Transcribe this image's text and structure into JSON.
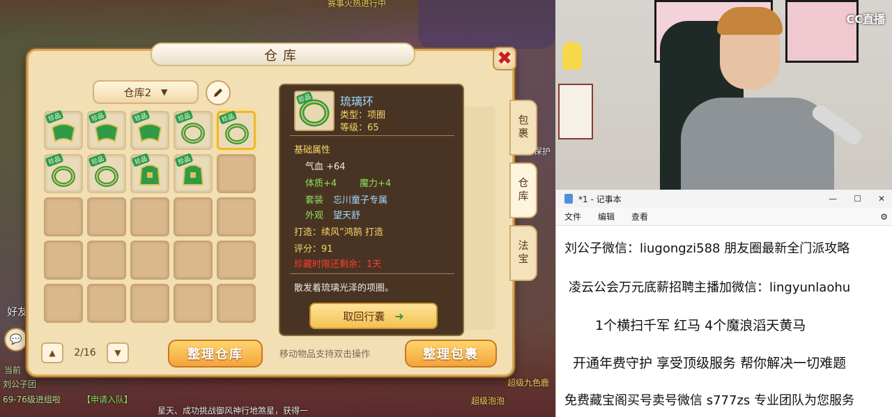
{
  "game": {
    "bg_texts": {
      "top_banner": "赛事火热进行中",
      "left_friend": "好友",
      "left_now": "当前",
      "party_recruit": "【申请入队】",
      "level_recruit": "69-76级进组啦",
      "bottom_scroll": "星天、成功挑战御风神行地煞星，获得一",
      "super_bubble": "超级泡泡",
      "super_nine": "超级九色鹿",
      "protect": "保护",
      "team_name": "刘公子团"
    },
    "window": {
      "title": "仓库",
      "close_symbol": "✖",
      "warehouse_select": "仓库2",
      "grid_slots": [
        {
          "filled": true,
          "tag": "珍品",
          "kind": "cloak"
        },
        {
          "filled": true,
          "tag": "珍品",
          "kind": "cloak"
        },
        {
          "filled": true,
          "tag": "珍品",
          "kind": "cloak"
        },
        {
          "filled": true,
          "tag": "珍品",
          "kind": "ring"
        },
        {
          "filled": true,
          "tag": "珍品",
          "kind": "ring",
          "selected": true
        },
        {
          "filled": true,
          "tag": "珍品",
          "kind": "ring"
        },
        {
          "filled": true,
          "tag": "珍品",
          "kind": "ring"
        },
        {
          "filled": true,
          "tag": "珍品",
          "kind": "armor"
        },
        {
          "filled": true,
          "tag": "珍品",
          "kind": "armor"
        },
        {
          "filled": false
        },
        {
          "filled": false
        },
        {
          "filled": false
        },
        {
          "filled": false
        },
        {
          "filled": false
        },
        {
          "filled": false
        },
        {
          "filled": false
        },
        {
          "filled": false
        },
        {
          "filled": false
        },
        {
          "filled": false
        },
        {
          "filled": false
        },
        {
          "filled": false
        },
        {
          "filled": false
        },
        {
          "filled": false
        },
        {
          "filled": false
        },
        {
          "filled": false
        }
      ],
      "page": "2/16",
      "sort_warehouse": "整理仓库",
      "sort_bag": "整理包裹",
      "hint": "移动物品支持双击操作",
      "tabs": [
        "包裹",
        "仓库",
        "法宝"
      ]
    },
    "tooltip": {
      "name": "琉璃环",
      "type": "类型：项圈",
      "level": "等级：65",
      "basic_attr_title": "基础属性",
      "hp": "气血 +64",
      "con": "体质+4",
      "magic": "魔力+4",
      "set_label": "套装",
      "set_value": "忘川童子专属",
      "look_label": "外观",
      "look_value": "望天舒",
      "craft": "打造：续风”鸿鹄  打造",
      "score": "评分：91",
      "expire": "珍藏时限还剩余：1天",
      "desc": "散发着琉璃光泽的项圈。",
      "button": "取回行囊",
      "tag": "珍品"
    }
  },
  "cam": {
    "logo": "CC直播"
  },
  "notepad": {
    "title": "*1 - 记事本",
    "controls": [
      "—",
      "☐",
      "✕"
    ],
    "menu": [
      "文件",
      "编辑",
      "查看"
    ],
    "lines": [
      "刘公子微信：liugongzi588 朋友圈最新全门派攻略",
      "凌云公会万元底薪招聘主播加微信：lingyunlaohu",
      "1个横扫千军 红马     4个魔浪滔天黄马",
      "开通年费守护 享受顶级服务 帮你解决一切难题",
      "免费藏宝阁买号卖号微信 s777zs 专业团队为您服务"
    ]
  },
  "colors": {
    "accent_orange": "#f3a43b",
    "tooltip_bg": "#3c2819",
    "item_green": "#2f9b46",
    "expire_red": "#ff3b2f"
  }
}
